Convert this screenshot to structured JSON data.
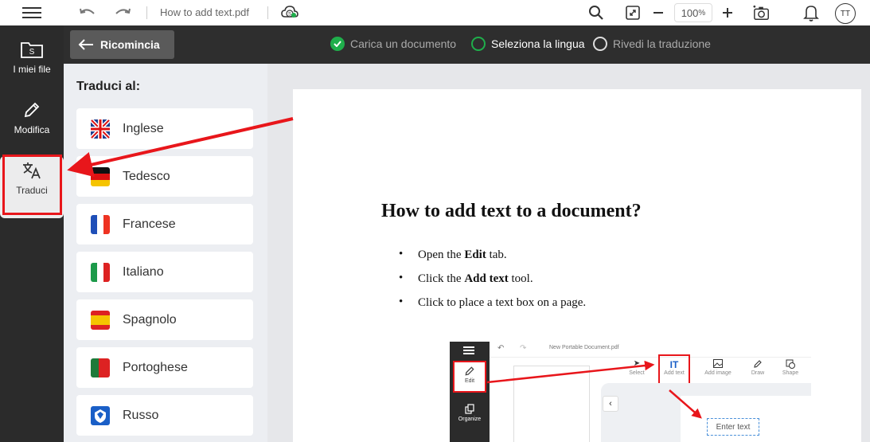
{
  "topbar": {
    "filename": "How to add text.pdf",
    "zoom": "100",
    "zoom_unit": "%",
    "avatar_initials": "TT"
  },
  "leftnav": {
    "items": [
      {
        "label": "I miei file"
      },
      {
        "label": "Modifica"
      },
      {
        "label": "Traduci"
      }
    ]
  },
  "stepbar": {
    "restart_label": "Ricomincia",
    "steps": [
      {
        "label": "Carica un documento",
        "state": "done"
      },
      {
        "label": "Seleziona la lingua",
        "state": "current"
      },
      {
        "label": "Rivedi la traduzione",
        "state": "todo"
      }
    ]
  },
  "languages": {
    "title": "Traduci al:",
    "items": [
      {
        "label": "Inglese",
        "flag": "uk-flag-icon"
      },
      {
        "label": "Tedesco",
        "flag": "germany-flag-icon"
      },
      {
        "label": "Francese",
        "flag": "france-flag-icon"
      },
      {
        "label": "Italiano",
        "flag": "italy-flag-icon"
      },
      {
        "label": "Spagnolo",
        "flag": "spain-flag-icon"
      },
      {
        "label": "Portoghese",
        "flag": "portugal-flag-icon"
      },
      {
        "label": "Russo",
        "flag": "russia-flag-icon"
      }
    ]
  },
  "document": {
    "title": "How to add text to a document?",
    "steps": [
      {
        "pre": "Open the ",
        "bold": "Edit",
        "post": " tab."
      },
      {
        "pre": "Click the ",
        "bold": "Add text",
        "post": " tool."
      },
      {
        "pre": "Click to place a text box on a page.",
        "bold": "",
        "post": ""
      }
    ],
    "screenshot": {
      "filename": "New Portable Document.pdf",
      "edit_label": "Edit",
      "organize_label": "Organize",
      "tools": [
        "Select",
        "Add text",
        "Add image",
        "Draw",
        "Shape"
      ],
      "placeholder": "Enter text"
    }
  },
  "colors": {
    "accent_red": "#e8161b",
    "step_green": "#1fae4b",
    "nav_dark": "#2b2b2b"
  }
}
